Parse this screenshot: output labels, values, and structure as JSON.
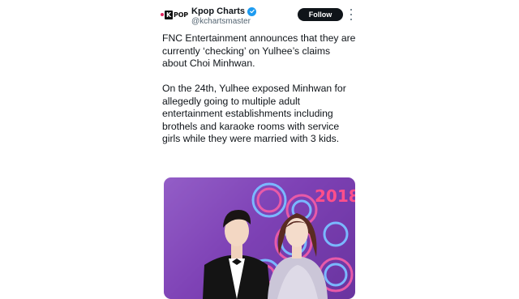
{
  "account": {
    "logo_text_k": "K",
    "logo_text_pop": "POP",
    "display_name": "Kpop Charts",
    "handle": "@kchartsmaster",
    "verified_icon": "verified-badge-icon"
  },
  "actions": {
    "follow_label": "Follow",
    "more_icon": "more-options-icon"
  },
  "tweet": {
    "paragraph_1": "FNC Entertainment announces that they are currently ‘checking’ on Yulhee’s claims about Choi Minhwan.",
    "paragraph_2": "On the 24th, Yulhee exposed Minhwan for allegedly going to multiple adult entertainment establishments including brothels and karaoke rooms with service girls while they were married with 3 kids."
  },
  "media": {
    "sign_text": "2018",
    "colors": {
      "background": "#7a3fb0",
      "sign_ring": "#e85aa8",
      "sign_ring_alt": "#7ab8ff",
      "digits": "#ff4f8b"
    }
  }
}
